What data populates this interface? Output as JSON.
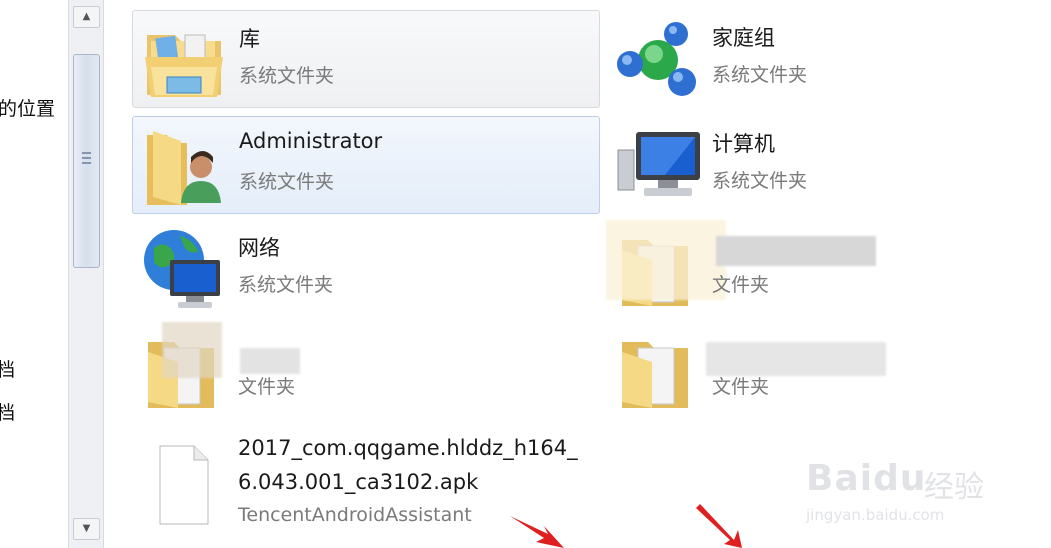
{
  "nav": {
    "items": [
      {
        "label": "的位置"
      },
      {
        "label": "档"
      },
      {
        "label": "档"
      }
    ]
  },
  "tiles": [
    {
      "name": "库",
      "type": "系统文件夹",
      "icon": "library-folder-icon",
      "state": "hover"
    },
    {
      "name": "家庭组",
      "type": "系统文件夹",
      "icon": "homegroup-icon",
      "state": "normal"
    },
    {
      "name": "Administrator",
      "type": "系统文件夹",
      "icon": "user-folder-icon",
      "state": "selected"
    },
    {
      "name": "计算机",
      "type": "系统文件夹",
      "icon": "computer-icon",
      "state": "normal"
    },
    {
      "name": "网络",
      "type": "系统文件夹",
      "icon": "network-icon",
      "state": "normal"
    },
    {
      "name": "",
      "type": "文件夹",
      "icon": "folder-icon",
      "state": "normal"
    },
    {
      "name": "",
      "type": "文件夹",
      "icon": "folder-icon",
      "state": "normal"
    },
    {
      "name": "",
      "type": "文件夹",
      "icon": "folder-icon",
      "state": "normal"
    }
  ],
  "file": {
    "name_line1": "2017_com.qqgame.hlddz_h164_",
    "name_line2": "6.043.001_ca3102.apk",
    "type": "TencentAndroidAssistant",
    "icon": "document-icon"
  },
  "watermark": {
    "brand": "Baidu",
    "brand_cn": "经验",
    "url": "jingyan.baidu.com"
  },
  "colors": {
    "selected_border": "#bcd0ea",
    "arrow": "#e02020"
  }
}
